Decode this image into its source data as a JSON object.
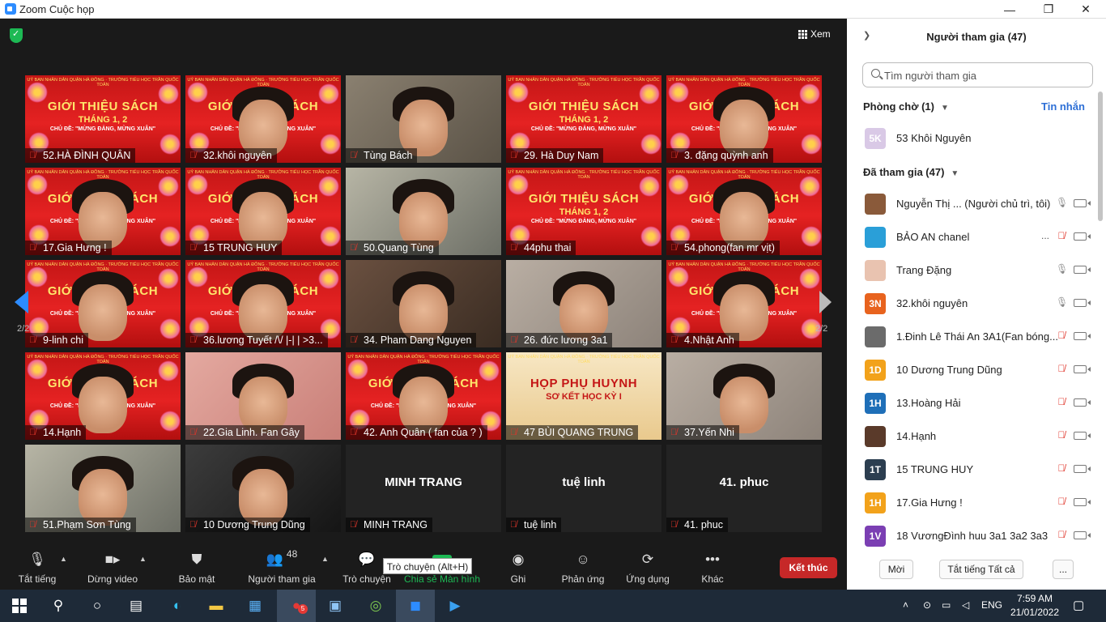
{
  "window": {
    "title": "Zoom Cuộc họp",
    "minimize": "—",
    "restore": "❐",
    "close": "✕"
  },
  "view_label": "Xem",
  "page_left": "2/2",
  "page_right": "2/2",
  "tiles": [
    {
      "label": "52.HÀ ĐÌNH QUÂN"
    },
    {
      "label": "32.khôi nguyên"
    },
    {
      "label": "Tùng Bách"
    },
    {
      "label": "29. Hà Duy Nam"
    },
    {
      "label": "3. đặng  quỳnh anh"
    },
    {
      "label": "17.Gia Hưng !"
    },
    {
      "label": "15 TRUNG HUY"
    },
    {
      "label": "50.Quang Tùng"
    },
    {
      "label": "44phu thai"
    },
    {
      "label": "54.phong(fan mr vịt)"
    },
    {
      "label": "9-linh chi"
    },
    {
      "label": "36.lương Tuyết /\\/ |-| |   >3..."
    },
    {
      "label": "34. Pham Dang Nguyen"
    },
    {
      "label": "26. đức lương 3a1"
    },
    {
      "label": "4.Nhật Anh"
    },
    {
      "label": "14.Hạnh"
    },
    {
      "label": "22.Gia Linh.    Fan Gây"
    },
    {
      "label": "42. Anh Quân ( fan của ? )"
    },
    {
      "label": "47 BÙI QUANG TRUNG"
    },
    {
      "label": "37.Yến Nhi"
    },
    {
      "label": "51.Phạm Sơn Tùng"
    },
    {
      "label": "10 Dương Trung Dũng"
    },
    {
      "label": "MINH TRANG",
      "big": "MINH TRANG"
    },
    {
      "label": "tuệ linh",
      "big": "tuệ linh"
    },
    {
      "label": "41. phuc",
      "big": "41. phuc"
    }
  ],
  "slide": {
    "header": "UỶ BAN NHÂN DÂN QUẬN HÀ ĐÔNG · TRƯỜNG TIỂU HỌC TRẦN QUỐC TOẢN",
    "title": "GIỚI THIỆU SÁCH",
    "subtitle": "THÁNG 1, 2",
    "theme": "CHỦ ĐỀ: \"MỪNG ĐẢNG, MỪNG XUÂN\"",
    "alt_title": "HỌP PHỤ HUYNH",
    "alt_sub": "SƠ KẾT HỌC KỲ I"
  },
  "toolbar": {
    "mute": "Tắt tiếng",
    "video": "Dừng video",
    "security": "Bảo mật",
    "participants": "Người tham gia",
    "participants_count": "48",
    "chat": "Trò chuyện",
    "share": "Chia sẻ Màn hình",
    "record": "Ghi",
    "reactions": "Phản ứng",
    "apps": "Ứng dụng",
    "more": "Khác",
    "end": "Kết thúc",
    "tooltip": "Trò chuyện (Alt+H)"
  },
  "panel": {
    "title": "Người tham gia (47)",
    "search_placeholder": "Tìm người tham gia",
    "waiting_title": "Phòng chờ (1)",
    "messages_link": "Tin nhắn",
    "waiting": [
      {
        "initials": "5K",
        "name": "53 Khôi Nguyên",
        "color": "#d9c9e6"
      }
    ],
    "joined_title": "Đã tham gia (47)",
    "participants": [
      {
        "initials": "",
        "name": "Nguyễn Thị ... (Người chủ trì, tôi)",
        "color": "#8a5a3a",
        "muted": false
      },
      {
        "initials": "",
        "name": "BẢO AN chanel",
        "color": "#2a9fd8",
        "muted": true,
        "more": "..."
      },
      {
        "initials": "",
        "name": "Trang Đặng",
        "color": "#e9c3b0",
        "muted": false
      },
      {
        "initials": "3N",
        "name": "32.khôi nguyên",
        "color": "#e8631e",
        "muted": false
      },
      {
        "initials": "",
        "name": "1.Đinh Lê Thái An 3A1(Fan bóng...",
        "color": "#6b6b6b",
        "muted": true
      },
      {
        "initials": "1D",
        "name": "10 Dương Trung Dũng",
        "color": "#f2a21b",
        "muted": true
      },
      {
        "initials": "1H",
        "name": "13.Hoàng Hải",
        "color": "#1f6fb8",
        "muted": true
      },
      {
        "initials": "",
        "name": "14.Hạnh",
        "color": "#5a3a2a",
        "muted": true
      },
      {
        "initials": "1T",
        "name": "15 TRUNG HUY",
        "color": "#2c3e50",
        "muted": true
      },
      {
        "initials": "1H",
        "name": "17.Gia Hưng !",
        "color": "#f2a21b",
        "muted": true
      },
      {
        "initials": "1V",
        "name": "18 VươngĐình huu 3a1 3a2 3a3",
        "color": "#7b3fb3",
        "muted": true
      }
    ],
    "invite": "Mời",
    "mute_all": "Tắt tiếng Tất cả",
    "more": "..."
  },
  "taskbar": {
    "lang": "ENG",
    "time": "7:59 AM",
    "date": "21/01/2022",
    "badge": "5"
  }
}
